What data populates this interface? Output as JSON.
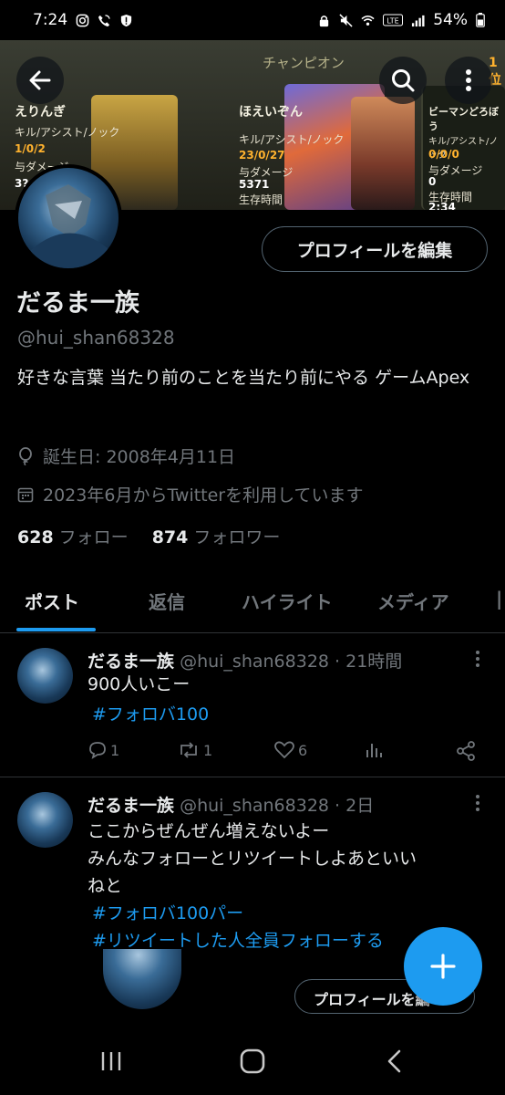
{
  "status_bar": {
    "time": "7:24",
    "battery": "54%",
    "icons": [
      "instagram-icon",
      "wifi-call-icon",
      "alert-shield-icon",
      "lock-icon",
      "mute-icon",
      "wifi-icon",
      "volte-icon",
      "signal-icon",
      "battery-icon"
    ]
  },
  "banner": {
    "title": "チャンピオン",
    "rank": "1位",
    "players": [
      {
        "name": "えりんぎ",
        "kills_label": "キル/アシスト/ノック",
        "kills": "1/0/2",
        "damage_label": "与ダメージ",
        "damage": "3?"
      },
      {
        "name": "ほえいぞん",
        "kills_label": "キル/アシスト/ノック",
        "kills": "23/0/27",
        "damage_label": "与ダメージ",
        "damage": "5371",
        "survival_label": "生存時間"
      },
      {
        "name": "ビーマンどろぼう",
        "kills_label": "キル/アシスト/ノック",
        "kills": "0/0/0",
        "damage_label": "与ダメージ",
        "damage": "0",
        "survival_label": "生存時間",
        "survival": "2:34"
      }
    ]
  },
  "header_buttons": {
    "back": "back-arrow-icon",
    "search": "search-icon",
    "more": "more-vertical-icon"
  },
  "profile": {
    "edit_button": "プロフィールを編集",
    "display_name": "だるま一族",
    "handle": "@hui_shan68328",
    "bio": "好きな言葉 当たり前のことを当たり前にやる ゲームApex",
    "birthday": "誕生日: 2008年4月11日",
    "joined": "2023年6月からTwitterを利用しています",
    "following_count": "628",
    "following_label": "フォロー",
    "followers_count": "874",
    "followers_label": "フォロワー"
  },
  "tabs": [
    "ポスト",
    "返信",
    "ハイライト",
    "メディア"
  ],
  "posts": [
    {
      "name": "だるま一族",
      "handle": "@hui_shan68328",
      "time": "· 21時間",
      "lines": [
        "900人いこー"
      ],
      "hashtags": [
        "#フォロバ100"
      ],
      "replies": "1",
      "retweets": "1",
      "likes": "6"
    },
    {
      "name": "だるま一族",
      "handle": "@hui_shan68328",
      "time": "· 2日",
      "lines": [
        "ここからぜんぜん増えないよー",
        "みんなフォローとリツイートしよあといい",
        "ねと"
      ],
      "hashtags": [
        "#フォロバ100パー",
        "#リツイートした人全員フォローする"
      ]
    }
  ],
  "embedded_card": {
    "edit_button": "プロフィールを編"
  },
  "fab": {
    "icon": "compose-plus-icon"
  },
  "nav": [
    "recent-apps-icon",
    "home-icon",
    "back-icon"
  ],
  "colors": {
    "accent": "#1d9bf0",
    "text": "#e7e9ea",
    "muted": "#71767b",
    "border": "#2f3336",
    "background": "#000000"
  }
}
